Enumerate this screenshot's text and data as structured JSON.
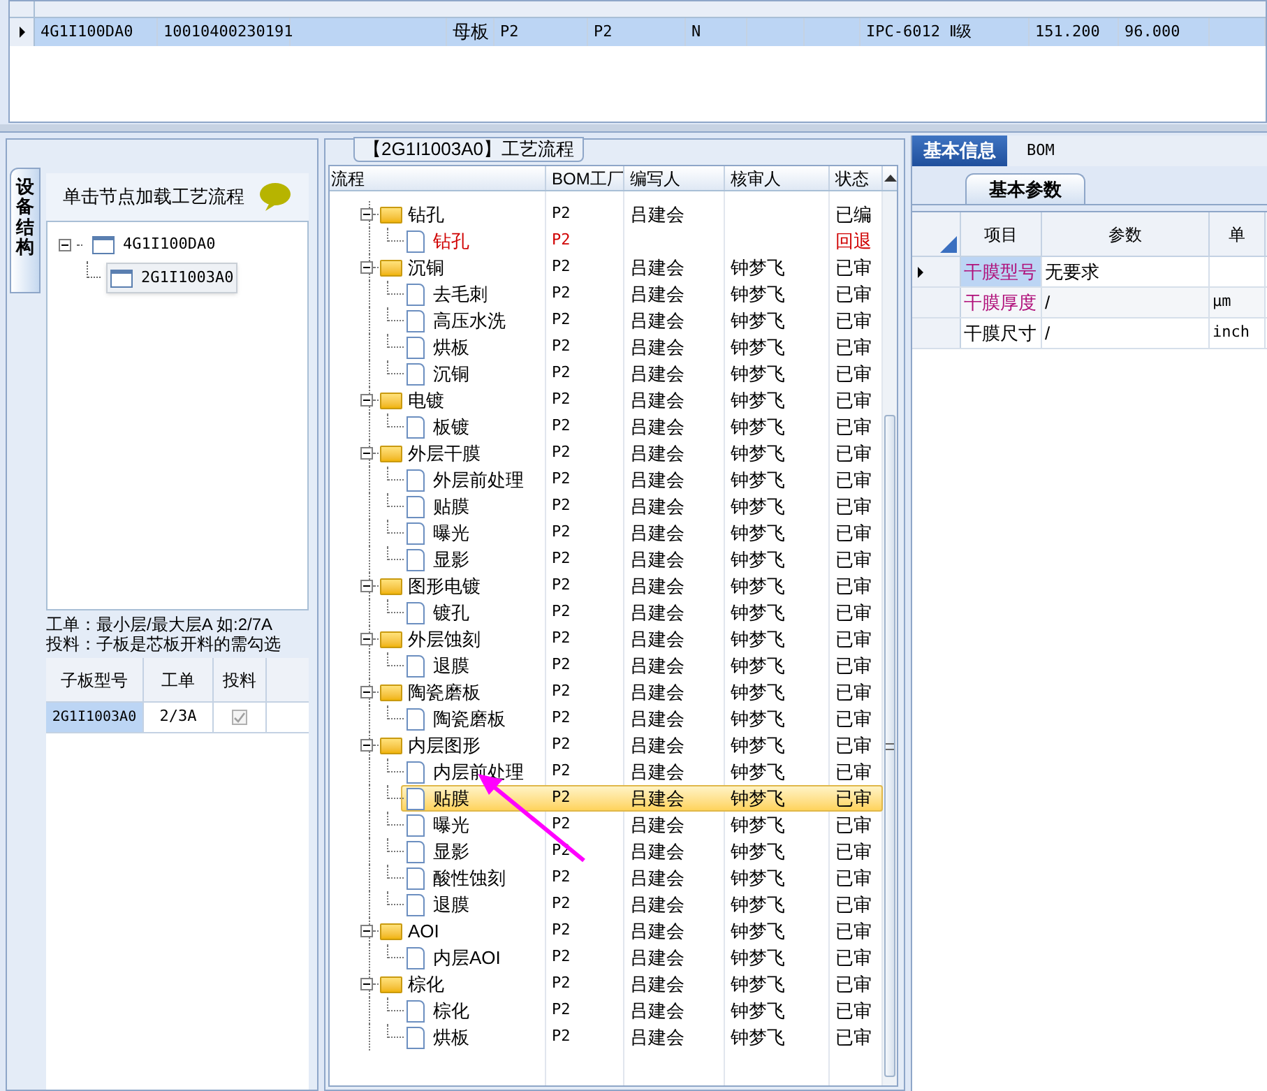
{
  "top_grid": {
    "rows": [
      {
        "selected": true,
        "cells": [
          "4G1I100DA0",
          "10010400230191",
          "",
          "母板",
          "P2",
          "P2",
          "N",
          "",
          "",
          "IPC-6012 Ⅱ级",
          "151.200",
          "96.000",
          ""
        ]
      }
    ]
  },
  "left_panel": {
    "side_tab": "设备结构",
    "hint": "单击节点加载工艺流程",
    "tree": [
      {
        "label": "4G1I100DA0",
        "expanded": true,
        "selected": false,
        "children": [
          {
            "label": "2G1I1003A0",
            "selected": true
          }
        ]
      }
    ],
    "notes": [
      "工单：最小层/最大层A 如:2/7A",
      "投料：子板是芯板开料的需勾选"
    ],
    "table": {
      "columns": [
        "子板型号",
        "工单",
        "投料"
      ],
      "rows": [
        {
          "board": "2G1I1003A0",
          "order": "2/3A",
          "checked": true
        }
      ]
    }
  },
  "process_panel": {
    "title": "【2G1I1003A0】工艺流程",
    "columns": [
      "流程",
      "BOM工厂",
      "编写人",
      "核审人",
      "状态"
    ],
    "tree": [
      {
        "name": "钻孔",
        "factory": "P2",
        "writer": "吕建会",
        "status": "已编",
        "returned": false,
        "selected": false,
        "children": [
          {
            "name": "钻孔",
            "factory": "P2",
            "status": "回退",
            "returned": true,
            "selected": false
          }
        ]
      },
      {
        "name": "沉铜",
        "factory": "P2",
        "writer": "吕建会",
        "reviewer": "钟梦飞",
        "status": "已审",
        "returned": false,
        "selected": false,
        "children": [
          {
            "name": "去毛刺",
            "factory": "P2",
            "writer": "吕建会",
            "reviewer": "钟梦飞",
            "status": "已审",
            "returned": false,
            "selected": false
          },
          {
            "name": "高压水洗",
            "factory": "P2",
            "writer": "吕建会",
            "reviewer": "钟梦飞",
            "status": "已审",
            "returned": false,
            "selected": false
          },
          {
            "name": "烘板",
            "factory": "P2",
            "writer": "吕建会",
            "reviewer": "钟梦飞",
            "status": "已审",
            "returned": false,
            "selected": false
          },
          {
            "name": "沉铜",
            "factory": "P2",
            "writer": "吕建会",
            "reviewer": "钟梦飞",
            "status": "已审",
            "returned": false,
            "selected": false
          }
        ]
      },
      {
        "name": "电镀",
        "factory": "P2",
        "writer": "吕建会",
        "reviewer": "钟梦飞",
        "status": "已审",
        "returned": false,
        "selected": false,
        "children": [
          {
            "name": "板镀",
            "factory": "P2",
            "writer": "吕建会",
            "reviewer": "钟梦飞",
            "status": "已审",
            "returned": false,
            "selected": false
          }
        ]
      },
      {
        "name": "外层干膜",
        "factory": "P2",
        "writer": "吕建会",
        "reviewer": "钟梦飞",
        "status": "已审",
        "returned": false,
        "selected": false,
        "children": [
          {
            "name": "外层前处理",
            "factory": "P2",
            "writer": "吕建会",
            "reviewer": "钟梦飞",
            "status": "已审",
            "returned": false,
            "selected": false
          },
          {
            "name": "贴膜",
            "factory": "P2",
            "writer": "吕建会",
            "reviewer": "钟梦飞",
            "status": "已审",
            "returned": false,
            "selected": false
          },
          {
            "name": "曝光",
            "factory": "P2",
            "writer": "吕建会",
            "reviewer": "钟梦飞",
            "status": "已审",
            "returned": false,
            "selected": false
          },
          {
            "name": "显影",
            "factory": "P2",
            "writer": "吕建会",
            "reviewer": "钟梦飞",
            "status": "已审",
            "returned": false,
            "selected": false
          }
        ]
      },
      {
        "name": "图形电镀",
        "factory": "P2",
        "writer": "吕建会",
        "reviewer": "钟梦飞",
        "status": "已审",
        "returned": false,
        "selected": false,
        "children": [
          {
            "name": "镀孔",
            "factory": "P2",
            "writer": "吕建会",
            "reviewer": "钟梦飞",
            "status": "已审",
            "returned": false,
            "selected": false
          }
        ]
      },
      {
        "name": "外层蚀刻",
        "factory": "P2",
        "writer": "吕建会",
        "reviewer": "钟梦飞",
        "status": "已审",
        "returned": false,
        "selected": false,
        "children": [
          {
            "name": "退膜",
            "factory": "P2",
            "writer": "吕建会",
            "reviewer": "钟梦飞",
            "status": "已审",
            "returned": false,
            "selected": false
          }
        ]
      },
      {
        "name": "陶瓷磨板",
        "factory": "P2",
        "writer": "吕建会",
        "reviewer": "钟梦飞",
        "status": "已审",
        "returned": false,
        "selected": false,
        "children": [
          {
            "name": "陶瓷磨板",
            "factory": "P2",
            "writer": "吕建会",
            "reviewer": "钟梦飞",
            "status": "已审",
            "returned": false,
            "selected": false
          }
        ]
      },
      {
        "name": "内层图形",
        "factory": "P2",
        "writer": "吕建会",
        "reviewer": "钟梦飞",
        "status": "已审",
        "returned": false,
        "selected": false,
        "children": [
          {
            "name": "内层前处理",
            "factory": "P2",
            "writer": "吕建会",
            "reviewer": "钟梦飞",
            "status": "已审",
            "returned": false,
            "selected": false
          },
          {
            "name": "贴膜",
            "factory": "P2",
            "writer": "吕建会",
            "reviewer": "钟梦飞",
            "status": "已审",
            "returned": false,
            "selected": true
          },
          {
            "name": "曝光",
            "factory": "P2",
            "writer": "吕建会",
            "reviewer": "钟梦飞",
            "status": "已审",
            "returned": false,
            "selected": false
          },
          {
            "name": "显影",
            "factory": "P2",
            "writer": "吕建会",
            "reviewer": "钟梦飞",
            "status": "已审",
            "returned": false,
            "selected": false
          },
          {
            "name": "酸性蚀刻",
            "factory": "P2",
            "writer": "吕建会",
            "reviewer": "钟梦飞",
            "status": "已审",
            "returned": false,
            "selected": false
          },
          {
            "name": "退膜",
            "factory": "P2",
            "writer": "吕建会",
            "reviewer": "钟梦飞",
            "status": "已审",
            "returned": false,
            "selected": false
          }
        ]
      },
      {
        "name": "AOI",
        "factory": "P2",
        "writer": "吕建会",
        "reviewer": "钟梦飞",
        "status": "已审",
        "returned": false,
        "selected": false,
        "children": [
          {
            "name": "内层AOI",
            "factory": "P2",
            "writer": "吕建会",
            "reviewer": "钟梦飞",
            "status": "已审",
            "returned": false,
            "selected": false
          }
        ]
      },
      {
        "name": "棕化",
        "factory": "P2",
        "writer": "吕建会",
        "reviewer": "钟梦飞",
        "status": "已审",
        "returned": false,
        "selected": false,
        "children": [
          {
            "name": "棕化",
            "factory": "P2",
            "writer": "吕建会",
            "reviewer": "钟梦飞",
            "status": "已审",
            "returned": false,
            "selected": false
          },
          {
            "name": "烘板",
            "factory": "P2",
            "writer": "吕建会",
            "reviewer": "钟梦飞",
            "status": "已审",
            "returned": false,
            "selected": false
          }
        ]
      }
    ]
  },
  "info_panel": {
    "tabs": [
      {
        "label": "基本信息",
        "selected": true
      },
      {
        "label": "BOM",
        "selected": false
      }
    ],
    "sub_tab": "基本参数",
    "columns": [
      "项目",
      "参数",
      "单"
    ],
    "rows": [
      {
        "item": "干膜型号",
        "value": "无要求",
        "unit": "",
        "highlighted": true,
        "selected": true
      },
      {
        "item": "干膜厚度",
        "value": "/",
        "unit": "μm",
        "highlighted": true,
        "selected": false
      },
      {
        "item": "干膜尺寸",
        "value": "/",
        "unit": "inch",
        "highlighted": false,
        "selected": false
      }
    ]
  }
}
